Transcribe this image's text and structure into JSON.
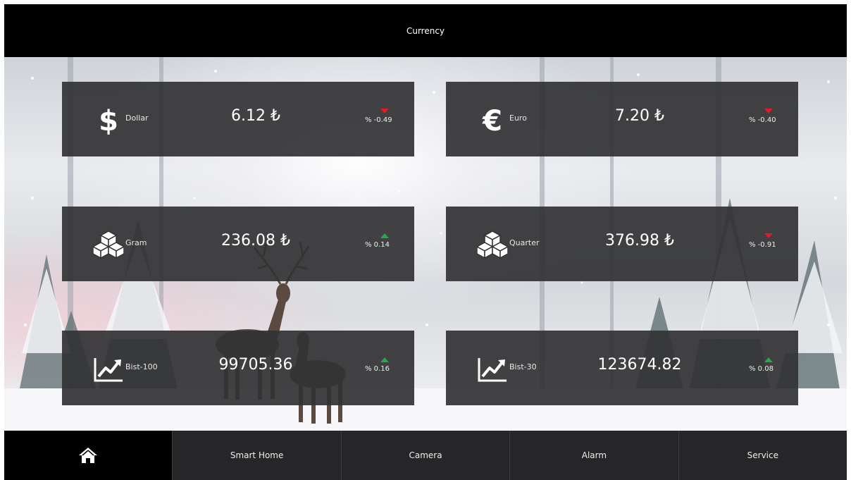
{
  "header": {
    "title": "Currency"
  },
  "cards": [
    {
      "icon": "dollar-icon",
      "name": "Dollar",
      "value": "6.12 ₺",
      "change": "% -0.49",
      "direction": "down"
    },
    {
      "icon": "euro-icon",
      "name": "Euro",
      "value": "7.20 ₺",
      "change": "% -0.40",
      "direction": "down"
    },
    {
      "icon": "gold-bars-icon",
      "name": "Gram",
      "value": "236.08 ₺",
      "change": "% 0.14",
      "direction": "up"
    },
    {
      "icon": "gold-bars-icon",
      "name": "Quarter",
      "value": "376.98 ₺",
      "change": "% -0.91",
      "direction": "down"
    },
    {
      "icon": "trend-chart-icon",
      "name": "Bist-100",
      "value": "99705.36",
      "change": "% 0.16",
      "direction": "up"
    },
    {
      "icon": "trend-chart-icon",
      "name": "Bist-30",
      "value": "123674.82",
      "change": "% 0.08",
      "direction": "up"
    }
  ],
  "nav": {
    "home_icon": "home-icon",
    "items": [
      "Smart Home",
      "Camera",
      "Alarm",
      "Service"
    ]
  },
  "colors": {
    "down": "#e31b23",
    "up": "#27a844",
    "card_bg": "#323234"
  }
}
